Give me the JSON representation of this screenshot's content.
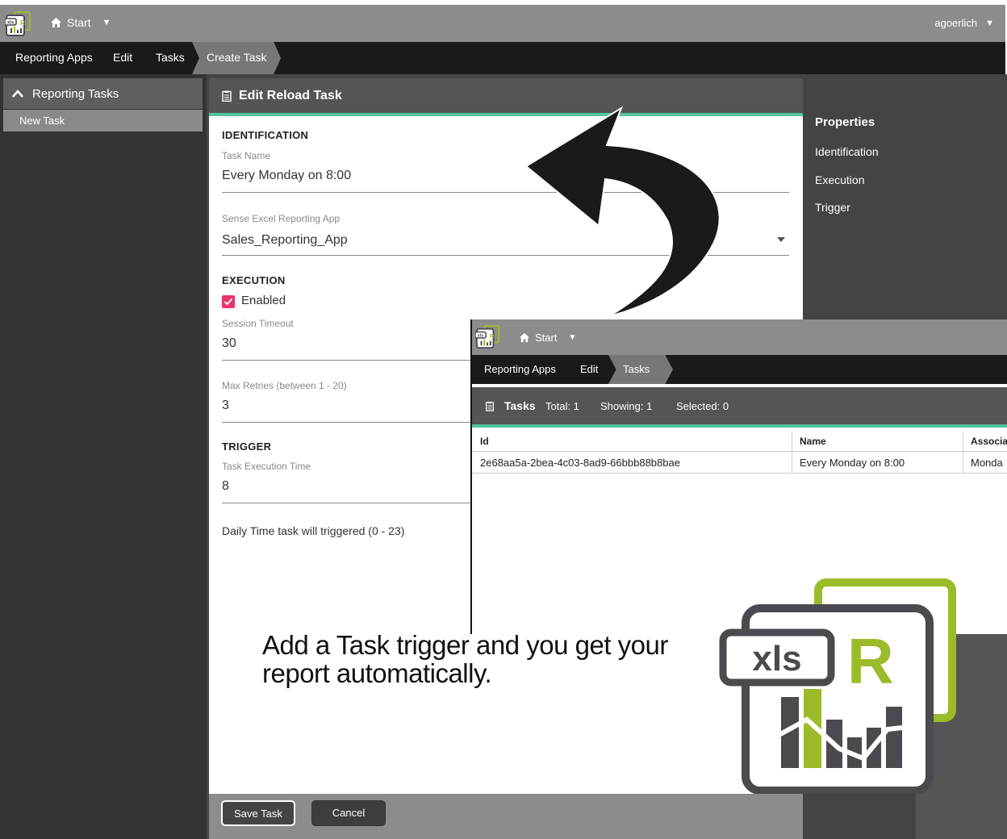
{
  "header": {
    "start_label": "Start",
    "username": "agoerlich"
  },
  "breadcrumb": {
    "items": [
      "Reporting Apps",
      "Edit",
      "Tasks"
    ],
    "active": "Create Task"
  },
  "sidebar": {
    "section_title": "Reporting Tasks",
    "items": [
      "New Task"
    ]
  },
  "form": {
    "title": "Edit Reload Task",
    "identification_heading": "IDENTIFICATION",
    "task_name_label": "Task Name",
    "task_name_value": "Every Monday on 8:00",
    "app_label": "Sense Excel Reporting App",
    "app_value": "Sales_Reporting_App",
    "execution_heading": "EXECUTION",
    "enabled_label": "Enabled",
    "enabled_checked": true,
    "session_timeout_label": "Session Timeout",
    "session_timeout_value": "30",
    "max_retries_label": "Max Retries (between 1 - 20)",
    "max_retries_value": "3",
    "trigger_heading": "TRIGGER",
    "exec_time_label": "Task Execution Time",
    "exec_time_value": "8",
    "exec_time_hint": "Daily Time task will triggered (0 - 23)",
    "save_label": "Save Task",
    "cancel_label": "Cancel"
  },
  "properties": {
    "title": "Properties",
    "items": [
      "Identification",
      "Execution",
      "Trigger"
    ]
  },
  "overlay": {
    "start_label": "Start",
    "breadcrumb": [
      "Reporting Apps",
      "Edit"
    ],
    "breadcrumb_active": "Tasks",
    "toolbar": {
      "title": "Tasks",
      "total": "Total: 1",
      "showing": "Showing: 1",
      "selected": "Selected: 0"
    },
    "columns": [
      "Id",
      "Name",
      "Associa"
    ],
    "rows": [
      [
        "2e68aa5a-2bea-4c03-8ad9-66bbb88b8bae",
        "Every Monday on 8:00",
        "Monda"
      ]
    ]
  },
  "caption": "Add a Task trigger and you get your report automatically.",
  "logo": {
    "text": "xls",
    "letter": "R"
  },
  "colors": {
    "accent_teal": "#52c4a0",
    "checkbox_pink": "#e8336b",
    "logo_green": "#9bbb2a",
    "logo_gray": "#4a4a4f"
  }
}
